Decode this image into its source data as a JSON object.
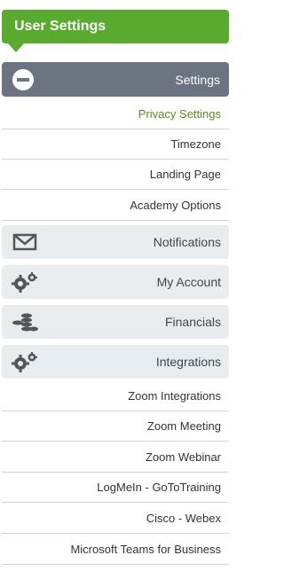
{
  "header": {
    "title": "User Settings"
  },
  "settings_section": {
    "label": "Settings",
    "icon": "minus-circle-icon"
  },
  "settings_items": [
    {
      "label": "Privacy Settings",
      "active": true
    },
    {
      "label": "Timezone"
    },
    {
      "label": "Landing Page"
    },
    {
      "label": "Academy Options"
    }
  ],
  "groups": {
    "notifications": {
      "label": "Notifications",
      "icon": "envelope-icon"
    },
    "my_account": {
      "label": "My Account",
      "icon": "gears-icon"
    },
    "financials": {
      "label": "Financials",
      "icon": "coins-icon"
    },
    "integrations": {
      "label": "Integrations",
      "icon": "gears-icon"
    }
  },
  "integration_items": [
    {
      "label": "Zoom Integrations"
    },
    {
      "label": "Zoom Meeting"
    },
    {
      "label": "Zoom Webinar"
    },
    {
      "label": "LogMeIn - GoToTraining"
    },
    {
      "label": "Cisco - Webex"
    },
    {
      "label": "Microsoft Teams for Business"
    }
  ],
  "colors": {
    "brand_green": "#5aaa2f",
    "section_gray": "#6b7480",
    "group_bg": "#e9ecef"
  }
}
